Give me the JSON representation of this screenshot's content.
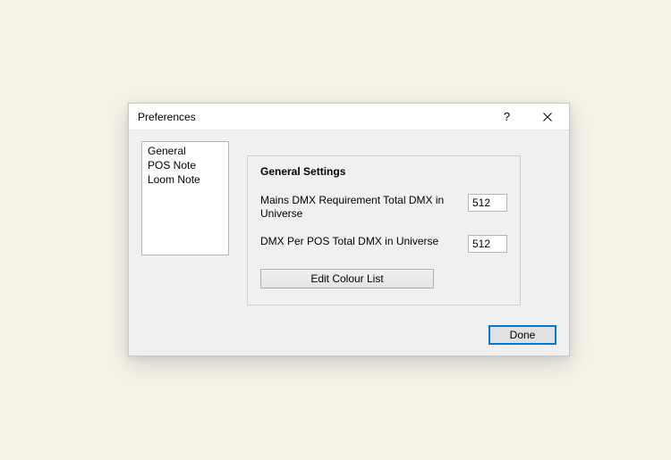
{
  "dialog": {
    "title": "Preferences",
    "help_tooltip": "?",
    "listbox": {
      "items": [
        "General",
        "POS Note",
        "Loom Note"
      ]
    },
    "group": {
      "title": "General Settings",
      "field1": {
        "label": "Mains  DMX Requirement Total DMX in Universe",
        "value": "512"
      },
      "field2": {
        "label": "DMX Per POS Total DMX in Universe",
        "value": "512"
      },
      "edit_colour_label": "Edit Colour List"
    },
    "done_label": "Done"
  }
}
